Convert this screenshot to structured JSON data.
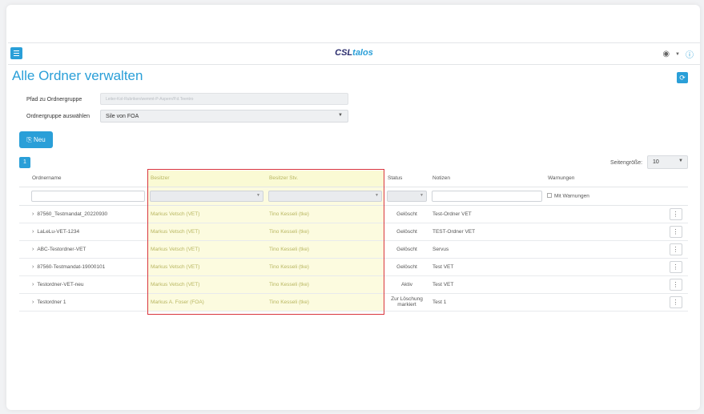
{
  "app": {
    "logo_part1": "CSL",
    "logo_part2": "talos"
  },
  "page": {
    "title": "Alle Ordner verwalten"
  },
  "form": {
    "path_label": "Pfad zu Ordnergruppe",
    "path_value": "Leiter-Kol-Rubriken/wemmt-P-Aspern/P.d.Teentro",
    "group_label": "Ordnergruppe auswählen",
    "group_value": "Sile von FOA"
  },
  "toolbar": {
    "new_label": "Neu",
    "new_icon": "⎘",
    "refresh_icon": "⟳"
  },
  "pagination": {
    "current_page": "1",
    "page_size_label": "Seitengröße:",
    "page_size_value": "10"
  },
  "table": {
    "headers": {
      "name": "Ordnername",
      "owner": "Besitzer",
      "owner_deputy": "Besitzer Stv.",
      "status": "Status",
      "notes": "Notizen",
      "warnings": "Warnungen"
    },
    "filter_warnings_label": "Mit Warnungen",
    "rows": [
      {
        "name": "87560_Testmandat_20220930",
        "owner": "Markus Vetsch (VET)",
        "owner_deputy": "Tino Kesseli (tke)",
        "status": "Gelöscht",
        "notes": "Test-Ordner VET",
        "warnings": ""
      },
      {
        "name": "LaLeLu-VET-1234",
        "owner": "Markus Vetsch (VET)",
        "owner_deputy": "Tino Kesseli (tke)",
        "status": "Gelöscht",
        "notes": "TEST-Ordner VET",
        "warnings": ""
      },
      {
        "name": "ABC-Testordner-VET",
        "owner": "Markus Vetsch (VET)",
        "owner_deputy": "Tino Kesseli (tke)",
        "status": "Gelöscht",
        "notes": "Servus",
        "warnings": ""
      },
      {
        "name": "87560-Testmandat-19000101",
        "owner": "Markus Vetsch (VET)",
        "owner_deputy": "Tino Kesseli (tke)",
        "status": "Gelöscht",
        "notes": "Test VET",
        "warnings": ""
      },
      {
        "name": "Testordner-VET-neu",
        "owner": "Markus Vetsch (VET)",
        "owner_deputy": "Tino Kesseli (tke)",
        "status": "Aktiv",
        "notes": "Test VET",
        "warnings": ""
      },
      {
        "name": "Testordner 1",
        "owner": "Markus A. Foser (FOA)",
        "owner_deputy": "Tino Kesseli (tke)",
        "status": "Zur Löschung markiert",
        "notes": "Test 1",
        "warnings": ""
      }
    ]
  },
  "colors": {
    "accent": "#2a9fd8",
    "highlight_border": "#d9363e",
    "highlight_fill": "#fcfbdf"
  }
}
